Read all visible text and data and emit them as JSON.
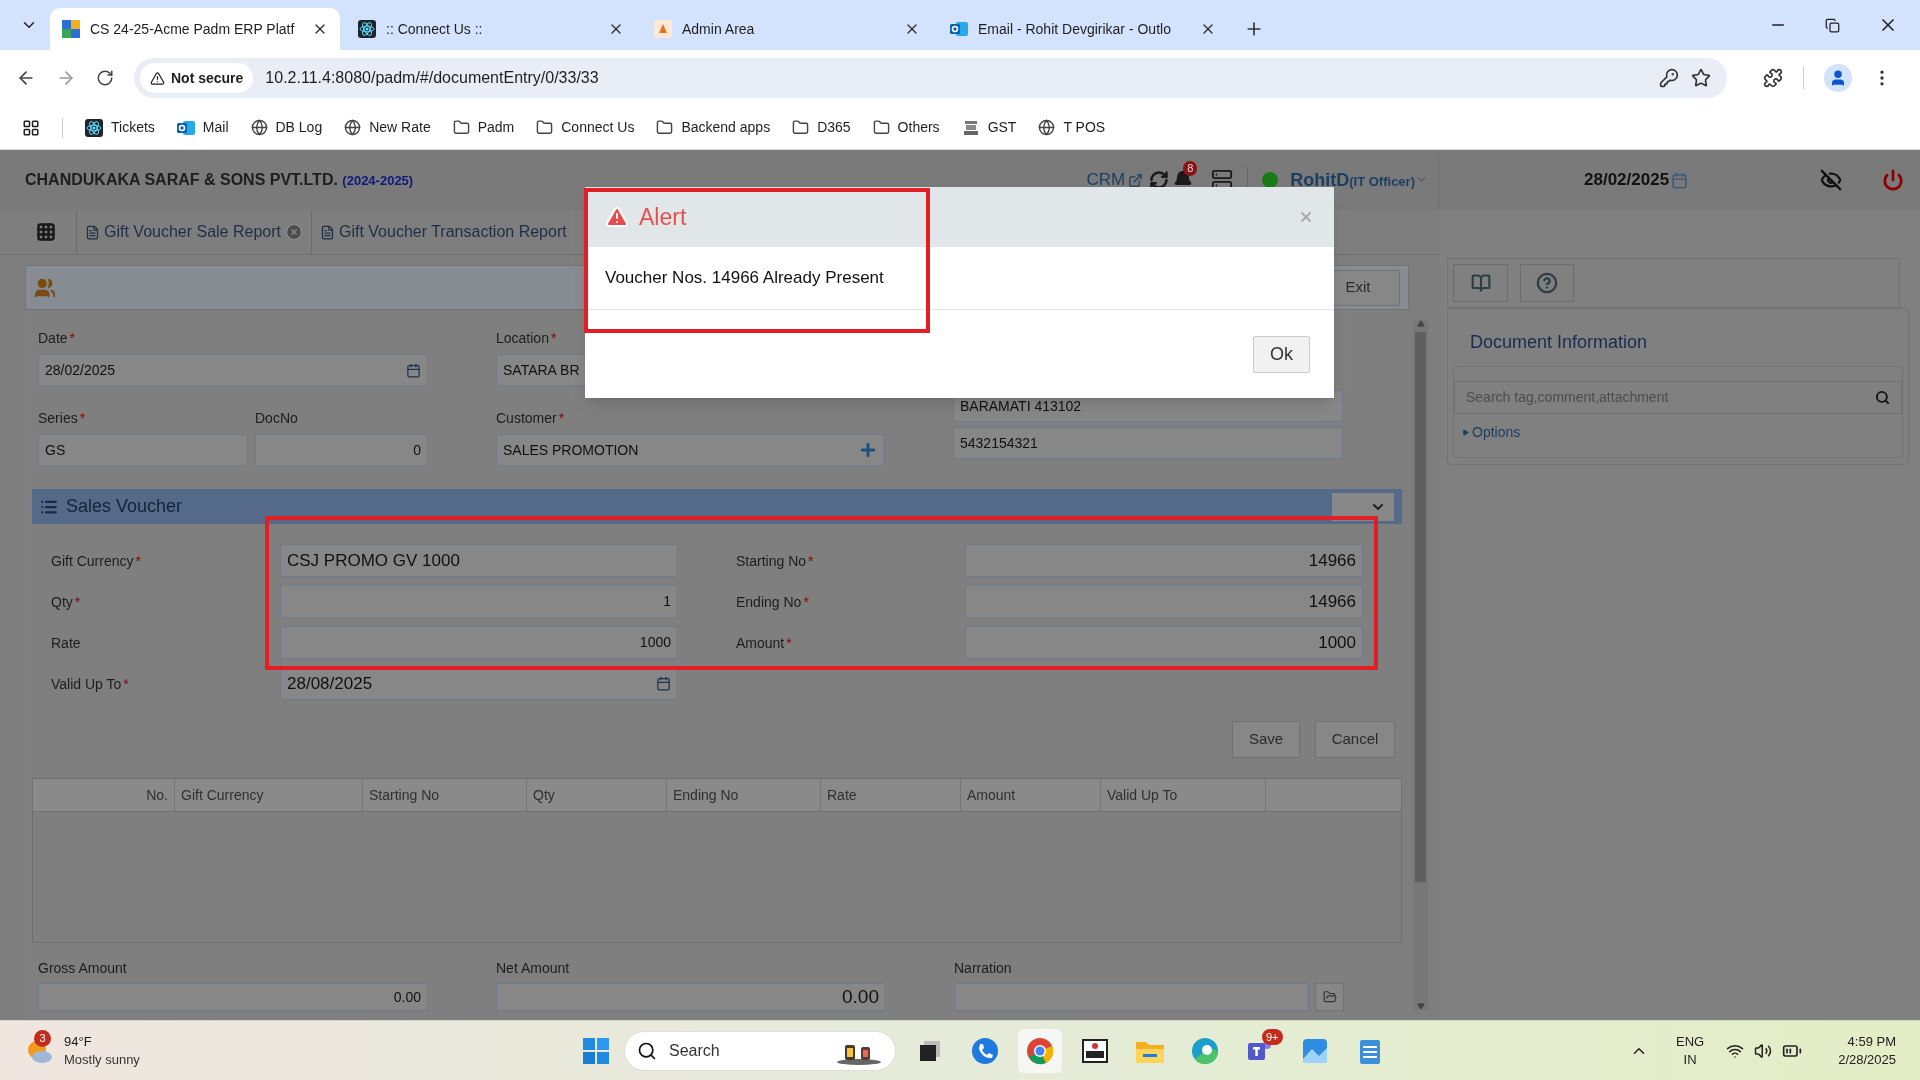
{
  "browser": {
    "tabs": [
      {
        "title": "CS 24-25-Acme Padm ERP Platf",
        "selected": true,
        "kind": "erp"
      },
      {
        "title": ":: Connect Us ::",
        "selected": false,
        "kind": "react"
      },
      {
        "title": "Admin Area",
        "selected": false,
        "kind": "admin"
      },
      {
        "title": "Email - Rohit Devgirikar - Outlo",
        "selected": false,
        "kind": "outlook"
      }
    ],
    "security": "Not secure",
    "url": "10.2.11.4:8080/padm/#/documentEntry/0/33/33",
    "bookmarks": [
      {
        "label": "Tickets",
        "kind": "react"
      },
      {
        "label": "Mail",
        "kind": "outlook"
      },
      {
        "label": "DB Log",
        "kind": "globe"
      },
      {
        "label": "New Rate",
        "kind": "globe"
      },
      {
        "label": "Padm",
        "kind": "folder"
      },
      {
        "label": "Connect Us",
        "kind": "folder"
      },
      {
        "label": "Backend apps",
        "kind": "folder"
      },
      {
        "label": "D365",
        "kind": "folder"
      },
      {
        "label": "Others",
        "kind": "folder"
      },
      {
        "label": "GST",
        "kind": "emblem"
      },
      {
        "label": "T POS",
        "kind": "globe"
      }
    ]
  },
  "app": {
    "company": "CHANDUKAKA SARAF & SONS PVT.LTD.",
    "year": "(2024-2025)",
    "crm": "CRM",
    "notifications": "8",
    "user": "RohitD",
    "role": "(IT Officer)",
    "date": "28/02/2025"
  },
  "doc_tabs": [
    {
      "label": "Gift Voucher Sale Report",
      "closable": true
    },
    {
      "label": "Gift Voucher Transaction Report",
      "closable": false
    }
  ],
  "toolbar": {
    "exit": "Exit"
  },
  "header_fields": [
    {
      "label": "Date",
      "mark": "*",
      "value": "28/02/2025",
      "kind": "date"
    },
    {
      "label": "Location",
      "mark": "*",
      "value": "SATARA BR",
      "kind": "text"
    },
    {
      "label": "Series",
      "mark": "*",
      "value": "GS",
      "kind": "text"
    },
    {
      "label": "DocNo",
      "value": "0",
      "kind": "number"
    },
    {
      "label": "Customer",
      "mark": "*",
      "value": "SALES PROMOTION",
      "kind": "lookup"
    }
  ],
  "address_lines": [
    "BARAMATI 413102",
    "5432154321"
  ],
  "sales_voucher": {
    "title": "Sales Voucher",
    "left_fields": [
      {
        "label": "Gift Currency",
        "mark": "*",
        "value": "CSJ PROMO GV 1000",
        "kind": "text"
      },
      {
        "label": "Qty",
        "mark": "*",
        "value": "1",
        "kind": "number"
      },
      {
        "label": "Rate",
        "value": "1000",
        "kind": "number"
      },
      {
        "label": "Valid Up To",
        "mark": "*",
        "value": "28/08/2025",
        "kind": "date"
      }
    ],
    "right_fields": [
      {
        "label": "Starting No",
        "mark": "*",
        "value": "14966",
        "kind": "number"
      },
      {
        "label": "Ending No",
        "mark": "*",
        "value": "14966",
        "kind": "number"
      },
      {
        "label": "Amount",
        "mark": "*",
        "value": "1000",
        "kind": "number"
      }
    ]
  },
  "buttons": [
    "Save",
    "Cancel"
  ],
  "table": {
    "columns": [
      "No.",
      "Gift Currency",
      "Starting No",
      "Qty",
      "Ending No",
      "Rate",
      "Amount",
      "Valid Up To"
    ]
  },
  "totals": [
    {
      "label": "Gross Amount",
      "value": "0.00",
      "kind": "small"
    },
    {
      "label": "Net Amount",
      "value": "0.00",
      "kind": "large"
    },
    {
      "label": "Narration",
      "kind": "attach"
    }
  ],
  "side_panel": {
    "title": "Document Information",
    "search_placeholder": "Search tag,comment,attachment",
    "options": "Options"
  },
  "dialog": {
    "title": "Alert",
    "message": "Voucher Nos. 14966 Already Present",
    "button": "Ok"
  },
  "taskbar": {
    "weather_badge": "3",
    "temperature": "94°F",
    "weather": "Mostly sunny",
    "search": "Search",
    "teams_badge": "9+",
    "language": "ENG",
    "region": "IN",
    "time": "4:59 PM",
    "date": "2/28/2025"
  }
}
